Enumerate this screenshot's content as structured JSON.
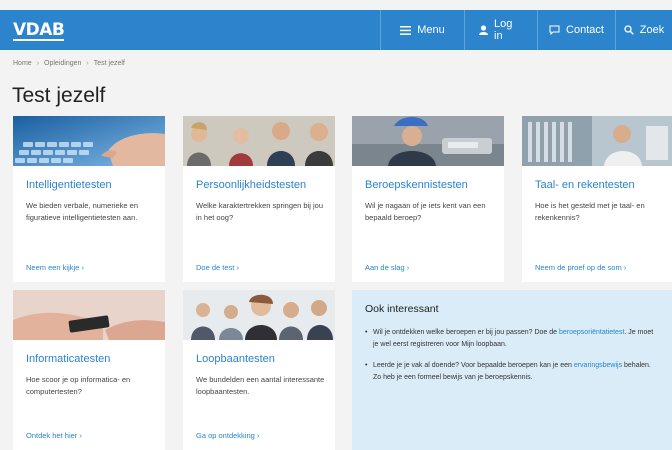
{
  "header": {
    "logo": "VDAB",
    "nav": [
      {
        "label": "Menu",
        "icon": "menu-icon"
      },
      {
        "label": "Log in",
        "icon": "user-icon"
      },
      {
        "label": "Contact",
        "icon": "chat-icon"
      },
      {
        "label": "Zoek",
        "icon": "search-icon"
      }
    ]
  },
  "breadcrumb": [
    "Home",
    "Opleidingen",
    "Test jezelf"
  ],
  "page_title": "Test jezelf",
  "cards": [
    {
      "title": "Intelligentietesten",
      "desc": "We bieden verbale, numerieke en figuratieve intelligentietesten aan.",
      "link": "Neem een kijkje ›"
    },
    {
      "title": "Persoonlijkheidstesten",
      "desc": "Welke karaktertrekken springen bij jou in het oog?",
      "link": "Doe de test ›"
    },
    {
      "title": "Beroepskennistesten",
      "desc": "Wil je nagaan of je iets kent van een bepaald beroep?",
      "link": "Aan de slag ›"
    },
    {
      "title": "Taal- en rekentesten",
      "desc": "Hoe is het gesteld met je taal- en rekenkennis?",
      "link": "Neem de proef op de som ›"
    },
    {
      "title": "Informaticatesten",
      "desc": "Hoe scoor je op informatica- en computertesten?",
      "link": "Ontdek het hier ›"
    },
    {
      "title": "Loopbaantesten",
      "desc": "We bundelden een aantal interessante loopbaantesten.",
      "link": "Ga op ontdekking ›"
    }
  ],
  "interesting": {
    "title": "Ook interessant",
    "item1_a": "Wil je ontdekken welke beroepen er bij jou passen? Doe de ",
    "item1_link": "beroepsoriëntatietest",
    "item1_b": ". Je moet je wel eerst registreren voor Mijn loopbaan.",
    "item2_a": "Leerde je je vak al doende? Voor bepaalde beroepen kan je een ",
    "item2_link": "ervaringsbewijs",
    "item2_b": " behalen. Zo heb je een formeel bewijs van je beroepskennis."
  },
  "colors": {
    "brand": "#2b84cc",
    "info_box": "#d9ecf8",
    "background": "#f3f3f3"
  }
}
